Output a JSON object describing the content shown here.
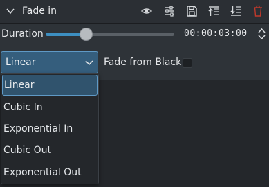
{
  "header": {
    "title": "Fade in",
    "icons": [
      "chevron-down-icon",
      "eye-icon",
      "sliders-icon",
      "save-icon",
      "move-up-icon",
      "move-down-icon",
      "delete-icon"
    ],
    "delete_color": "#c0392b"
  },
  "duration": {
    "label": "Duration",
    "timecode": "00:00:03:00",
    "slider_fraction": 0.31
  },
  "curve": {
    "selected": "Linear",
    "options": [
      "Linear",
      "Cubic In",
      "Exponential In",
      "Cubic Out",
      "Exponential Out"
    ]
  },
  "fade_from_black": {
    "label": "Fade from Black",
    "checked": false
  },
  "colors": {
    "accent": "#3d8fc1",
    "selection": "#30536d"
  }
}
